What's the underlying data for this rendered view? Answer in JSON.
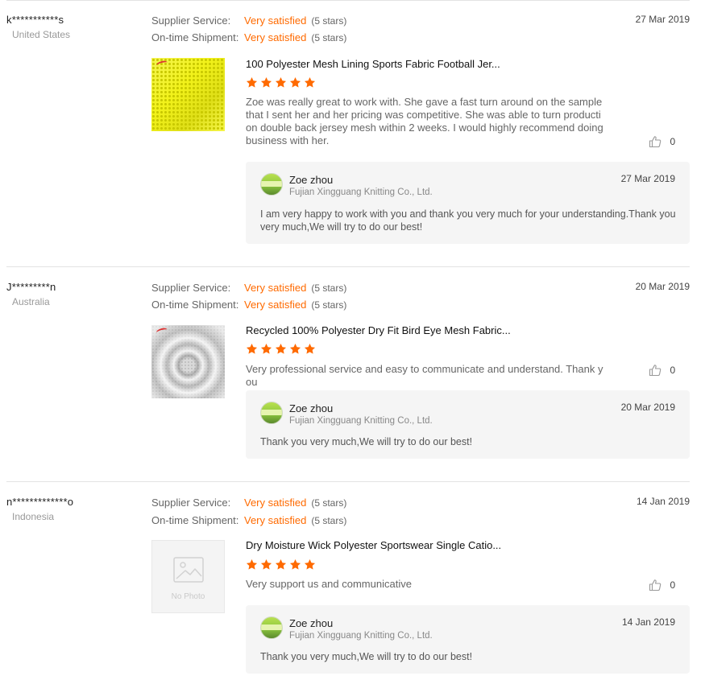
{
  "colors": {
    "accent": "#ff6a00",
    "reply_bg": "#f5f5f5",
    "divider": "#e3e3e3"
  },
  "reviews": [
    {
      "buyer": "k***********s",
      "country": "United States",
      "date": "27 Mar 2019",
      "supplier_service_label": "Supplier Service:",
      "supplier_service_value": "Very satisfied",
      "supplier_service_stars": "(5 stars)",
      "shipment_label": "On-time Shipment:",
      "shipment_value": "Very satisfied",
      "shipment_stars": "(5 stars)",
      "thumb": "yellow-mesh-fabric-image",
      "product_title": "100 Polyester Mesh Lining Sports Fabric Football Jer...",
      "rating": 5,
      "text": "Zoe was really great to work with. She gave a fast turn around on the sample that I sent her and her pricing was competitive. She was able to turn production double back  jersey mesh within 2 weeks. I would highly recommend doing business with her.",
      "likes": "0",
      "reply": {
        "name": "Zoe zhou",
        "company": "Fujian Xingguang Knitting Co., Ltd.",
        "date": "27 Mar 2019",
        "text": "I am very happy to work with you and thank you very much for your understanding.Thank you very much,We will try to do our best!"
      }
    },
    {
      "buyer": "J*********n",
      "country": "Australia",
      "date": "20 Mar 2019",
      "supplier_service_label": "Supplier Service:",
      "supplier_service_value": "Very satisfied",
      "supplier_service_stars": "(5 stars)",
      "shipment_label": "On-time Shipment:",
      "shipment_value": "Very satisfied",
      "shipment_stars": "(5 stars)",
      "thumb": "white-mesh-fabric-image",
      "product_title": "Recycled 100% Polyester Dry Fit Bird Eye Mesh Fabric...",
      "rating": 5,
      "text": "Very professional service and easy to communicate and understand. Thank you",
      "likes": "0",
      "reply": {
        "name": "Zoe zhou",
        "company": "Fujian Xingguang Knitting Co., Ltd.",
        "date": "20 Mar 2019",
        "text": "Thank you very much,We will try to do our best!"
      }
    },
    {
      "buyer": "n*************o",
      "country": "Indonesia",
      "date": "14 Jan 2019",
      "supplier_service_label": "Supplier Service:",
      "supplier_service_value": "Very satisfied",
      "supplier_service_stars": "(5 stars)",
      "shipment_label": "On-time Shipment:",
      "shipment_value": "Very satisfied",
      "shipment_stars": "(5 stars)",
      "thumb": "no-photo-placeholder",
      "no_photo_text": "No Photo",
      "product_title": "Dry Moisture Wick Polyester Sportswear Single Catio...",
      "rating": 5,
      "text": "Very support us and communicative",
      "likes": "0",
      "reply": {
        "name": "Zoe zhou",
        "company": "Fujian Xingguang Knitting Co., Ltd.",
        "date": "14 Jan 2019",
        "text": "Thank you very much,We will try to do our best!"
      }
    }
  ]
}
